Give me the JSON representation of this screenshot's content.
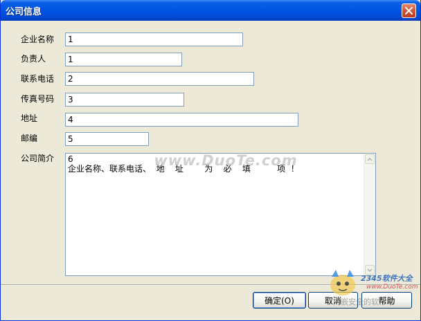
{
  "window": {
    "title": "公司信息"
  },
  "form": {
    "fields": [
      {
        "label": "企业名称",
        "value": "1"
      },
      {
        "label": "负责人",
        "value": "1"
      },
      {
        "label": "联系电话",
        "value": "2"
      },
      {
        "label": "传真号码",
        "value": "3"
      },
      {
        "label": "地址",
        "value": "4"
      },
      {
        "label": "邮编",
        "value": "5"
      }
    ],
    "profile": {
      "label": "公司简介",
      "value": "6\n企业名称、联系电话、  地    址        为    必    填          项  ！"
    }
  },
  "buttons": {
    "ok": "确定(O)",
    "cancel": "取消",
    "help": "帮助"
  },
  "watermark": "www.DuoTe.com",
  "logo": {
    "brand": "2345软件大全",
    "url": "www.DuoTe.com",
    "caption": "内嵌安全的软件站"
  },
  "colors": {
    "titlebar": "#0054e3",
    "window_bg": "#ece9d8",
    "field_border": "#7f9db9",
    "close_button": "#c33a1f"
  }
}
